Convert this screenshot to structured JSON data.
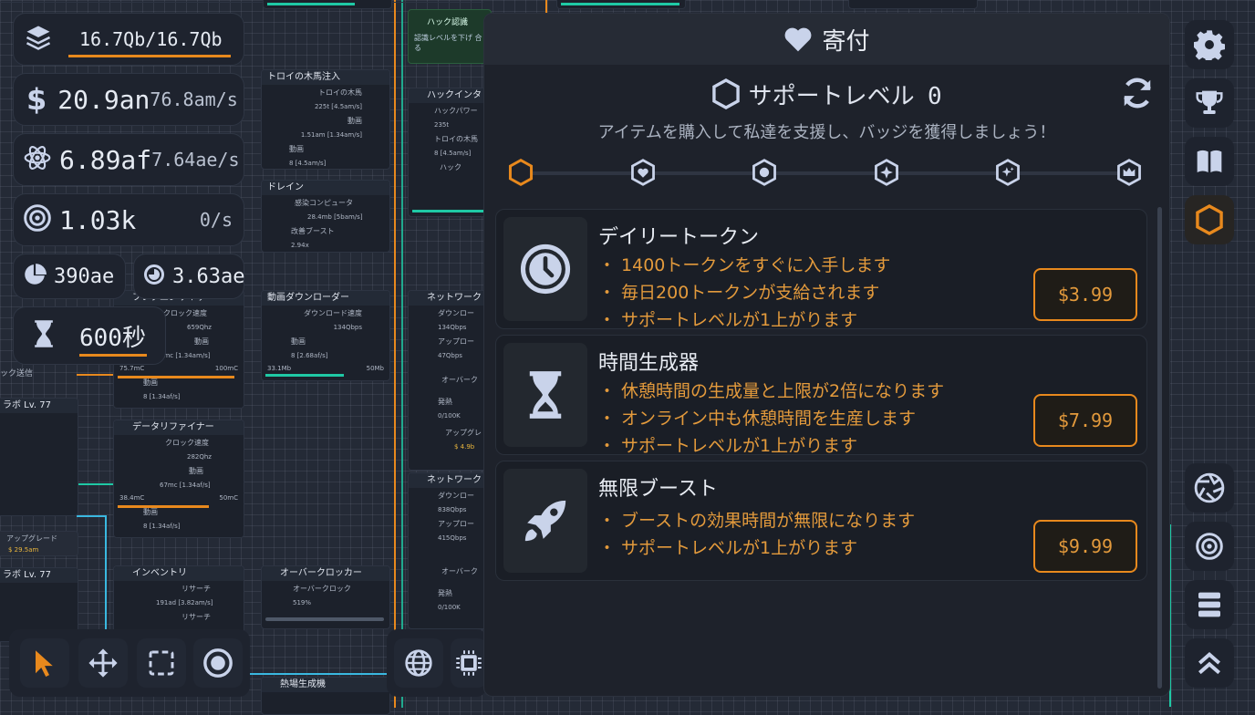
{
  "resources": {
    "storage": "16.7Qb/16.7Qb",
    "money": "20.9an",
    "money_rate": "76.8am/s",
    "research": "6.89af",
    "research_rate": "7.64ae/s",
    "tokens": "1.03k",
    "tokens_rate": "0/s",
    "pie": "390ae",
    "cycle": "3.63ae",
    "time": "600秒"
  },
  "nodes": {
    "trojan": "トロイの木馬注入",
    "trojan_row1": "トロイの木馬",
    "trojan_row1_val": "225t [4.5am/s]",
    "trojan_row2": "動画",
    "trojan_row2_val": "1.51am [1.34am/s]",
    "trojan_row3": "動画",
    "trojan_row3_val": "8 [4.5am/s]",
    "hack_intern": "ハックインタ",
    "hack_power": "ハックパワー",
    "hack_power_val": "235t",
    "hack_trojan": "トロイの木馬",
    "hack_trojan_val": "8 [4.5am/s]",
    "hack_x": "ハック",
    "drain": "ドレイン",
    "drain_row1": "感染コンピュータ",
    "drain_row1_val": "28.4mb [5bam/s]",
    "drain_row2": "改善ブースト",
    "drain_row2_val": "2.94x",
    "video_dl": "動画ダウンローダー",
    "dl_speed": "ダウンロード速度",
    "dl_speed_val": "134Qbps",
    "dl_row2": "動画",
    "dl_row2_val": "8 [2.68af/s]",
    "dl_bar_left": "33.1Mb",
    "dl_bar_right": "50Mb",
    "network1": "ネットワーク",
    "net_dl": "ダウンロー",
    "net_dl_val": "134Qbps",
    "net_ul": "アップロー",
    "net_ul_val": "47Qbps",
    "net_over": "オーバーク",
    "net_fire": "発熱",
    "net_fire_val": "0/100K",
    "net_upgrade": "アップグレ",
    "net_upgrade_val": "$ 4.9b",
    "freq": "フレクエンサイザー",
    "freq_row1": "クロック速度",
    "freq_row1_val": "659Qhz",
    "freq_row2": "動画",
    "freq_row2_val": "9mc [1.34am/s]",
    "freq_bar_left": "75.7mC",
    "freq_bar_right": "100mC",
    "freq_row3": "動画",
    "freq_row3_val": "8 [1.34af/s]",
    "data_refiner": "データリファイナー",
    "dr_row1": "クロック速度",
    "dr_row1_val": "282Qhz",
    "dr_row2": "動画",
    "dr_row2_val": "67mc [1.34af/s]",
    "dr_bar_left": "38.4mC",
    "dr_bar_right": "50mC",
    "dr_row3": "動画",
    "dr_row3_val": "8 [1.34af/s]",
    "network2": "ネットワーク",
    "net2_dl_val": "838Qbps",
    "net2_ul_val": "415Qbps",
    "inventory": "インベントリ",
    "inv_row1": "リサーチ",
    "inv_row1_val": "191ad [3.82am/s]",
    "inv_row2": "リサーチ",
    "overclocker": "オーバークロッカー",
    "oc_row1": "オーバークロック",
    "oc_row1_val": "519%",
    "factory": "熱場生成機",
    "lab1": "ラボ Lv. 77",
    "lab2": "ラボ Lv. 77",
    "hack_aware": "ハック認識",
    "hack_aware_sub": "認識レベルを下げ 合る",
    "left_send": "ック送信",
    "left_upgrade": "アップグレード",
    "left_upgrade_val": "$ 29.5am"
  },
  "modal": {
    "title": "寄付",
    "support_level_label": "サポートレベル",
    "support_level_value": "0",
    "subtitle": "アイテムを購入して私達を支援し、バッジを獲得しましょう！",
    "items": [
      {
        "title": "デイリートークン",
        "features": [
          "1400トークンをすぐに入手します",
          "毎日200トークンが支給されます",
          "サポートレベルが1上がります"
        ],
        "price": "$3.99",
        "icon": "clock-icon"
      },
      {
        "title": "時間生成器",
        "features": [
          "休憩時間の生成量と上限が2倍になります",
          "オンライン中も休憩時間を生産します",
          "サポートレベルが1上がります"
        ],
        "price": "$7.99",
        "icon": "hourglass-icon"
      },
      {
        "title": "無限ブースト",
        "features": [
          "ブーストの効果時間が無限になります",
          "サポートレベルが1上がります"
        ],
        "price": "$9.99",
        "icon": "rocket-icon"
      }
    ]
  },
  "colors": {
    "accent": "#e8891d",
    "panel": "#1e232e",
    "text": "#e6ebf3",
    "icon": "#c9d3ea"
  }
}
